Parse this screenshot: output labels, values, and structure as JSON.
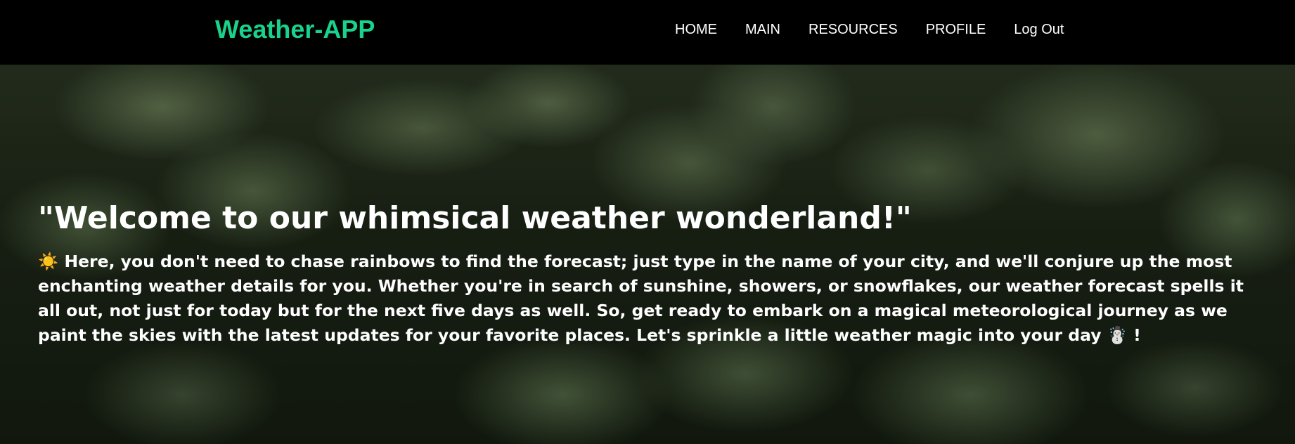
{
  "navbar": {
    "brand": "Weather-APP",
    "links": [
      {
        "label": "HOME"
      },
      {
        "label": "MAIN"
      },
      {
        "label": "RESOURCES"
      },
      {
        "label": "PROFILE"
      },
      {
        "label": "Log Out"
      }
    ]
  },
  "hero": {
    "title": "\"Welcome to our whimsical weather wonderland!\"",
    "text": "☀️ Here, you don't need to chase rainbows to find the forecast; just type in the name of your city, and we'll conjure up the most enchanting weather details for you. Whether you're in search of sunshine, showers, or snowflakes, our weather forecast spells it all out, not just for today but for the next five days as well. So, get ready to embark on a magical meteorological journey as we paint the skies with the latest updates for your favorite places. Let's sprinkle a little weather magic into your day ☃️ !"
  }
}
